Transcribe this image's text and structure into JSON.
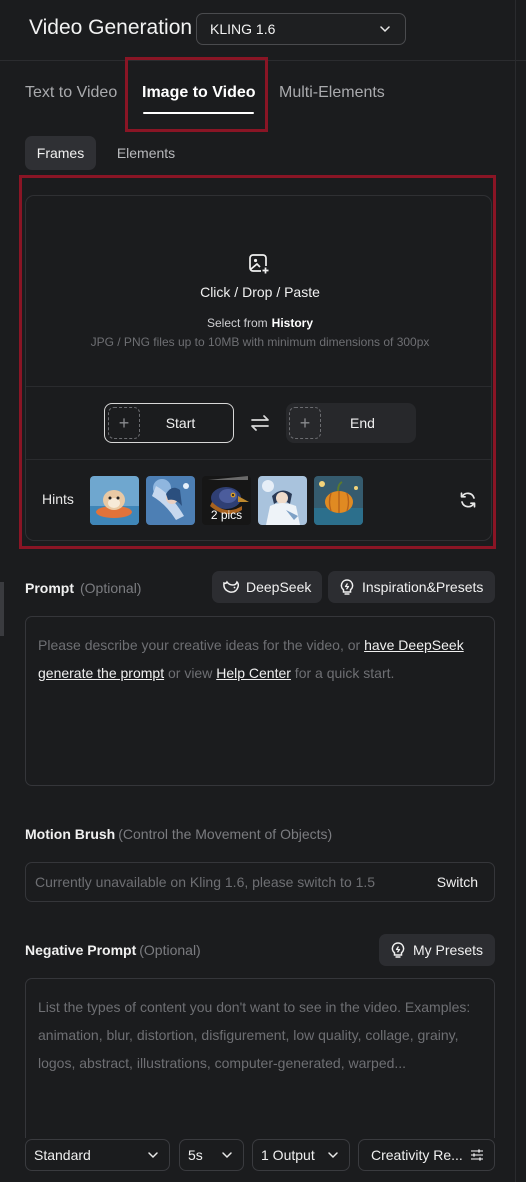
{
  "header": {
    "title": "Video Generation",
    "model": "KLING 1.6"
  },
  "tabs": [
    {
      "label": "Text to Video"
    },
    {
      "label": "Image to Video"
    },
    {
      "label": "Multi-Elements"
    }
  ],
  "subtabs": [
    {
      "label": "Frames"
    },
    {
      "label": "Elements"
    }
  ],
  "upload": {
    "title": "Click / Drop / Paste",
    "select_prefix": "Select from",
    "select_link": "History",
    "hint": "JPG / PNG files up to 10MB with minimum dimensions of 300px",
    "start_label": "Start",
    "end_label": "End"
  },
  "hints": {
    "label": "Hints",
    "pics_label": "2 pics"
  },
  "prompt": {
    "label": "Prompt",
    "optional": "(Optional)",
    "deepseek_label": "DeepSeek",
    "presets_label": "Inspiration&Presets",
    "text_1": "Please describe your creative ideas for the video, or ",
    "link_1": "have DeepSeek generate the prompt",
    "text_2": " or view ",
    "link_2": "Help Center",
    "text_3": " for a quick start."
  },
  "motion_brush": {
    "label": "Motion Brush",
    "sub": "(Control the Movement of Objects)",
    "placeholder": "Currently unavailable on Kling 1.6, please switch to 1.5",
    "switch_label": "Switch"
  },
  "negative_prompt": {
    "label": "Negative Prompt",
    "optional": "(Optional)",
    "presets_label": "My Presets",
    "placeholder": "List the types of content you don't want to see in the video. Examples: animation, blur, distortion, disfigurement, low quality, collage, grainy, logos, abstract, illustrations, computer-generated, warped..."
  },
  "bottom": {
    "mode": "Standard",
    "duration": "5s",
    "outputs": "1 Output",
    "creativity": "Creativity Re..."
  },
  "colors": {
    "highlight": "#8a1525",
    "background": "#1b1c1e"
  }
}
